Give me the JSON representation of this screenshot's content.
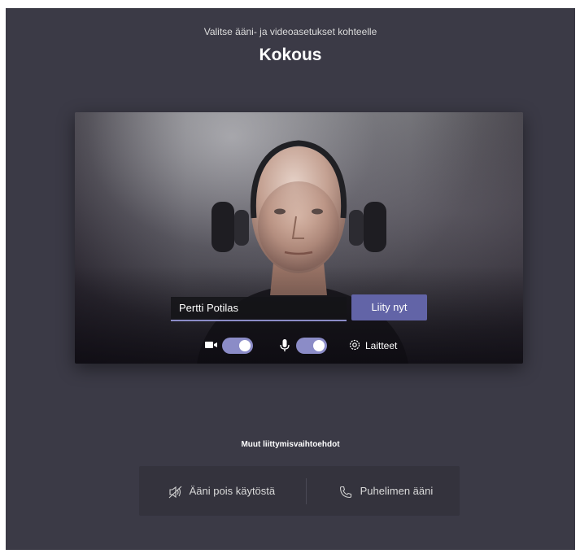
{
  "header": {
    "subtitle": "Valitse ääni- ja videoasetukset kohteelle",
    "title": "Kokous"
  },
  "preview": {
    "name_value": "Pertti Potilas",
    "join_label": "Liity nyt",
    "camera_toggle_on": true,
    "mic_toggle_on": true,
    "devices_label": "Laitteet"
  },
  "other_options": {
    "heading": "Muut liittymisvaihtoehdot",
    "items": [
      {
        "label": "Ääni pois käytöstä",
        "icon": "speaker-off-icon"
      },
      {
        "label": "Puhelimen ääni",
        "icon": "phone-icon"
      }
    ]
  },
  "colors": {
    "background": "#3b3a46",
    "accent": "#6264a7",
    "toggle": "#8b8cc7",
    "panel": "#34333d"
  }
}
